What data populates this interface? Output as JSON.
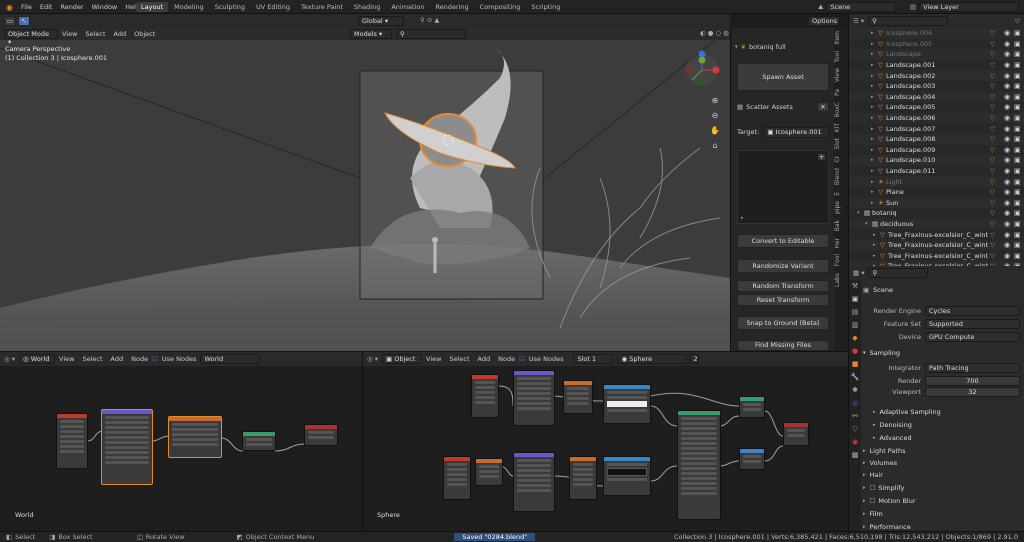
{
  "menu": [
    "File",
    "Edit",
    "Render",
    "Window",
    "Help"
  ],
  "workspaces": [
    "Layout",
    "Modeling",
    "Sculpting",
    "UV Editing",
    "Texture Paint",
    "Shading",
    "Animation",
    "Rendering",
    "Compositing",
    "Scripting"
  ],
  "active_workspace": "Layout",
  "scene_field": "Scene",
  "view_layer_field": "View Layer",
  "transform_orientation": "Global",
  "options_label": "Options",
  "viewport": {
    "mode": "Object Mode",
    "menus": [
      "View",
      "Select",
      "Add",
      "Object"
    ],
    "overlay_line1": "Camera Perspective",
    "overlay_line2": "(1) Collection 3 | Icosphere.001",
    "models_dropdown": "Models"
  },
  "npanel": {
    "title": "botaniq full",
    "spawn": "Spawn Asset",
    "scatter": "Scatter Assets",
    "target_label": "Target:",
    "target_value": "Icosphere.001",
    "buttons": [
      "Convert to Editable",
      "Randomize Variant",
      "Random Transform",
      "Reset Transform",
      "Snap to Ground (Beta)",
      "Find Missing Files"
    ],
    "tabs": [
      "Item",
      "Tool",
      "View",
      "Pa",
      "BoxC",
      "KIT",
      "Slot",
      "Cr",
      "Blend",
      "E",
      "pipe",
      "Bak",
      "Her",
      "Fool",
      "Labs"
    ]
  },
  "outliner": {
    "rows": [
      {
        "name": "Icosphere.004",
        "icon": "cone-icon",
        "dim": true
      },
      {
        "name": "Icosphere.005",
        "icon": "cone-icon",
        "dim": true
      },
      {
        "name": "Landscape",
        "icon": "landscape-icon",
        "dim": true
      },
      {
        "name": "Landscape.001",
        "icon": "landscape-icon",
        "dim": false
      },
      {
        "name": "Landscape.002",
        "icon": "landscape-icon",
        "dim": false
      },
      {
        "name": "Landscape.003",
        "icon": "landscape-icon",
        "dim": false
      },
      {
        "name": "Landscape.004",
        "icon": "landscape-icon",
        "dim": false
      },
      {
        "name": "Landscape.005",
        "icon": "landscape-icon",
        "dim": false
      },
      {
        "name": "Landscape.006",
        "icon": "landscape-icon",
        "dim": false
      },
      {
        "name": "Landscape.007",
        "icon": "landscape-icon",
        "dim": false
      },
      {
        "name": "Landscape.008",
        "icon": "landscape-icon",
        "dim": false
      },
      {
        "name": "Landscape.009",
        "icon": "landscape-icon",
        "dim": false
      },
      {
        "name": "Landscape.010",
        "icon": "landscape-icon",
        "dim": false
      },
      {
        "name": "Landscape.011",
        "icon": "landscape-icon",
        "dim": false
      },
      {
        "name": "Light",
        "icon": "light-icon",
        "dim": true
      },
      {
        "name": "Plane",
        "icon": "landscape-icon",
        "dim": false
      },
      {
        "name": "Sun",
        "icon": "sun-icon",
        "dim": false
      },
      {
        "name": "botaniq",
        "icon": "collection-icon",
        "dim": false
      },
      {
        "name": "deciduous",
        "icon": "collection-icon",
        "dim": false
      },
      {
        "name": "Tree_Fraxinus-excelsior_C_wint",
        "icon": "landscape-icon",
        "dim": false
      },
      {
        "name": "Tree_Fraxinus-excelsior_C_wint",
        "icon": "landscape-icon",
        "dim": false
      },
      {
        "name": "Tree_Fraxinus-excelsior_C_wint",
        "icon": "landscape-icon",
        "dim": false
      },
      {
        "name": "Tree_Fraxinus-excelsior_C_wint",
        "icon": "landscape-icon",
        "dim": false
      }
    ]
  },
  "properties": {
    "header": "Scene",
    "render_engine_label": "Render Engine",
    "render_engine": "Cycles",
    "feature_set_label": "Feature Set",
    "feature_set": "Supported",
    "device_label": "Device",
    "device": "GPU Compute",
    "sampling": "Sampling",
    "integrator_label": "Integrator",
    "integrator": "Path Tracing",
    "render_label": "Render",
    "render_samples": "700",
    "viewport_label": "Viewport",
    "viewport_samples": "32",
    "sections": [
      "Adaptive Sampling",
      "Denoising",
      "Advanced",
      "Light Paths",
      "Volumes",
      "Hair",
      "Simplify",
      "Motion Blur",
      "Film",
      "Performance"
    ]
  },
  "node_left": {
    "type": "World",
    "menus": [
      "View",
      "Select",
      "Add",
      "Node"
    ],
    "use_nodes": "Use Nodes",
    "datablock": "World",
    "label": "World"
  },
  "node_right": {
    "type": "Object",
    "menus": [
      "View",
      "Select",
      "Add",
      "Node"
    ],
    "use_nodes": "Use Nodes",
    "slot": "Slot 1",
    "material": "Sphere",
    "users": "2",
    "label": "Sphere"
  },
  "status": {
    "select": "Select",
    "box_select": "Box Select",
    "rotate": "Rotate View",
    "context": "Object Context Menu",
    "saved": "Saved \"0284.blend\"",
    "stats": "Collection 3 | Icosphere.001 | Verts:6,385,421 | Faces:6,510,198 | Tris:12,543,212 | Objects:1/869 | 2.91.0"
  },
  "colors": {
    "accent": "#e5892f",
    "selected": "#4772b3",
    "gizmo_x": "#d43a3a",
    "gizmo_y": "#6aa830",
    "gizmo_z": "#3a6fd4"
  }
}
